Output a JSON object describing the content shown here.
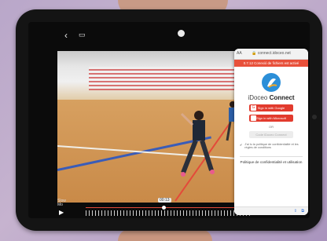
{
  "video_player": {
    "slow_mo_label": "Slow\nMo",
    "time_badge": "00:13"
  },
  "browser_panel": {
    "url": "connect.idoceo.net",
    "url_prefix": "AA",
    "notice": "0.7.12 Conexió de fichiers est activé",
    "brand_light": "iDoceo",
    "brand_bold": "Connect",
    "google_button": "Sign in with Google",
    "microsoft_button": "Sign in with Microsoft",
    "or_label": "OR",
    "email_button": "Code iDoceo Connect",
    "checkbox_text": "J'ai lu la politique de confidentialité et les règles de conditions",
    "policy_title": "Politique de confidentialité et utilisation"
  },
  "colors": {
    "accent_red": "#e23b2e",
    "logo_blue": "#2c8fd8"
  }
}
